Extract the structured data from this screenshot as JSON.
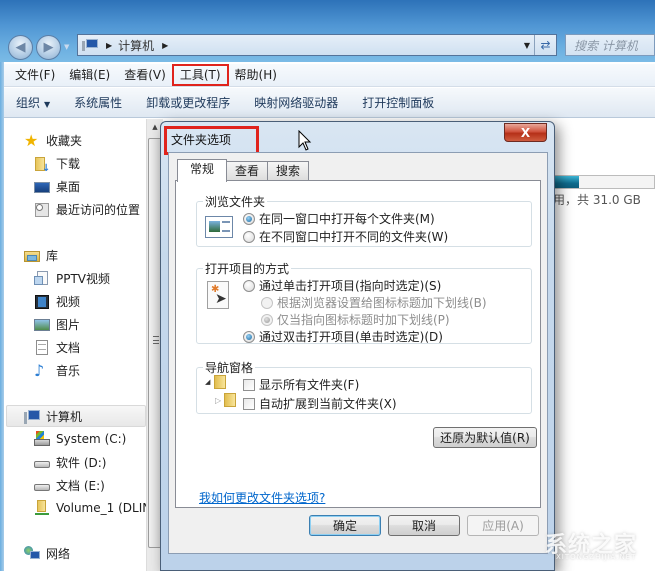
{
  "explorer": {
    "address": {
      "path_item": "计算机",
      "search_placeholder": "搜索 计算机"
    },
    "menu": [
      {
        "label": "文件(F)"
      },
      {
        "label": "编辑(E)"
      },
      {
        "label": "查看(V)"
      },
      {
        "label": "工具(T)",
        "highlighted": true
      },
      {
        "label": "帮助(H)"
      }
    ],
    "toolbar": [
      {
        "label": "组织",
        "has_dropdown": true
      },
      {
        "label": "系统属性"
      },
      {
        "label": "卸载或更改程序"
      },
      {
        "label": "映射网络驱动器"
      },
      {
        "label": "打开控制面板"
      }
    ],
    "sidebar": {
      "favorites": {
        "label": "收藏夹",
        "items": [
          {
            "label": "下载"
          },
          {
            "label": "桌面"
          },
          {
            "label": "最近访问的位置"
          }
        ]
      },
      "libraries": {
        "label": "库",
        "items": [
          {
            "label": "PPTV视频"
          },
          {
            "label": "视频"
          },
          {
            "label": "图片"
          },
          {
            "label": "文档"
          },
          {
            "label": "音乐"
          }
        ]
      },
      "computer": {
        "label": "计算机",
        "items": [
          {
            "label": "System (C:)"
          },
          {
            "label": "软件 (D:)"
          },
          {
            "label": "文档 (E:)"
          },
          {
            "label": "Volume_1 (DLIN"
          }
        ]
      },
      "network": {
        "label": "网络"
      }
    },
    "drive_info": {
      "text": "用，共 31.0 GB",
      "used_fraction": 0.25
    }
  },
  "dialog": {
    "title": "文件夹选项",
    "close_label": "X",
    "tabs": [
      {
        "label": "常规",
        "active": true
      },
      {
        "label": "查看"
      },
      {
        "label": "搜索"
      }
    ],
    "browse_folders": {
      "title": "浏览文件夹",
      "options": [
        {
          "label": "在同一窗口中打开每个文件夹(M)",
          "selected": true
        },
        {
          "label": "在不同窗口中打开不同的文件夹(W)",
          "selected": false
        }
      ]
    },
    "click_items": {
      "title": "打开项目的方式",
      "options": [
        {
          "label": "通过单击打开项目(指向时选定)(S)",
          "selected": false,
          "enabled": true
        },
        {
          "label": "根据浏览器设置给图标标题加下划线(B)",
          "selected": false,
          "enabled": false
        },
        {
          "label": "仅当指向图标标题时加下划线(P)",
          "selected": true,
          "enabled": false
        },
        {
          "label": "通过双击打开项目(单击时选定)(D)",
          "selected": true,
          "enabled": true
        }
      ]
    },
    "navigation_pane": {
      "title": "导航窗格",
      "options": [
        {
          "label": "显示所有文件夹(F)",
          "checked": false
        },
        {
          "label": "自动扩展到当前文件夹(X)",
          "checked": false
        }
      ]
    },
    "restore_defaults_label": "还原为默认值(R)",
    "help_link": "我如何更改文件夹选项?",
    "buttons": {
      "ok": "确定",
      "cancel": "取消",
      "apply": "应用(A)"
    }
  },
  "watermark": {
    "main": "系统之家",
    "sub": "XITONGZHIJIA.NET"
  }
}
